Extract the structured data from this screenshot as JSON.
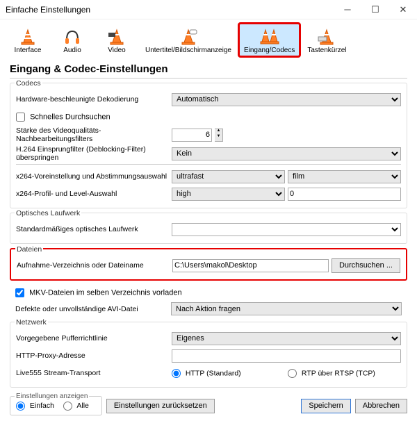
{
  "window": {
    "title": "Einfache Einstellungen"
  },
  "toolbar": [
    {
      "label": "Interface"
    },
    {
      "label": "Audio"
    },
    {
      "label": "Video"
    },
    {
      "label": "Untertitel/Bildschirmanzeige"
    },
    {
      "label": "Eingang/Codecs"
    },
    {
      "label": "Tastenkürzel"
    }
  ],
  "heading": "Eingang & Codec-Einstellungen",
  "codecs": {
    "title": "Codecs",
    "hw_label": "Hardware-beschleunigte Dekodierung",
    "hw_value": "Automatisch",
    "fast_seek": "Schnelles Durchsuchen",
    "postproc_label": "Stärke des Videoqualitäts-Nachbearbeitungsfilters",
    "postproc_value": "6",
    "h264_label": "H.264 Einsprungfilter (Deblocking-Filter) überspringen",
    "h264_value": "Kein",
    "x264_preset_label": "x264-Voreinstellung und Abstimmungsauswahl",
    "x264_preset_value": "ultrafast",
    "x264_tune_value": "film",
    "x264_profile_label": "x264-Profil- und Level-Auswahl",
    "x264_profile_value": "high",
    "x264_level_value": "0"
  },
  "optical": {
    "title": "Optisches Laufwerk",
    "drive_label": "Standardmäßiges optisches Laufwerk",
    "drive_value": ""
  },
  "files": {
    "title": "Dateien",
    "rec_label": "Aufnahme-Verzeichnis oder Dateiname",
    "rec_value": "C:\\Users\\makol\\Desktop",
    "browse": "Durchsuchen ...",
    "mkv_preload": "MKV-Dateien im selben Verzeichnis vorladen",
    "avi_label": "Defekte oder unvollständige AVI-Datei",
    "avi_value": "Nach Aktion fragen"
  },
  "network": {
    "title": "Netzwerk",
    "cache_label": "Vorgegebene Pufferrichtlinie",
    "cache_value": "Eigenes",
    "proxy_label": "HTTP-Proxy-Adresse",
    "proxy_value": "",
    "live555_label": "Live555 Stream-Transport",
    "http_option": "HTTP (Standard)",
    "rtp_option": "RTP über RTSP (TCP)"
  },
  "footer": {
    "show_settings": "Einstellungen anzeigen",
    "simple": "Einfach",
    "all": "Alle",
    "reset": "Einstellungen zurücksetzen",
    "save": "Speichern",
    "cancel": "Abbrechen"
  }
}
